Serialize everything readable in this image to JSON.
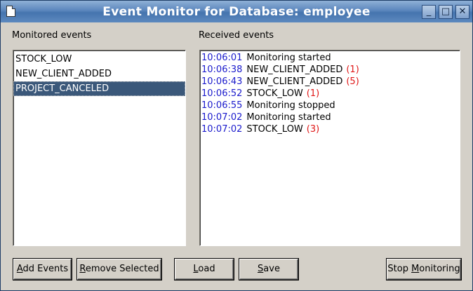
{
  "window": {
    "title": "Event Monitor for Database: employee",
    "min": "_",
    "max": "□",
    "close": "✕"
  },
  "monitored": {
    "label": "Monitored events",
    "items": [
      "STOCK_LOW",
      "NEW_CLIENT_ADDED",
      "PROJECT_CANCELED"
    ],
    "selected_index": 2
  },
  "received": {
    "label": "Received events",
    "rows": [
      {
        "time": "10:06:01",
        "message": "Monitoring started",
        "count": ""
      },
      {
        "time": "10:06:38",
        "message": "NEW_CLIENT_ADDED",
        "count": "(1)"
      },
      {
        "time": "10:06:43",
        "message": "NEW_CLIENT_ADDED",
        "count": "(5)"
      },
      {
        "time": "10:06:52",
        "message": "STOCK_LOW",
        "count": "(1)"
      },
      {
        "time": "10:06:55",
        "message": "Monitoring stopped",
        "count": ""
      },
      {
        "time": "10:07:02",
        "message": "Monitoring started",
        "count": ""
      },
      {
        "time": "10:07:02",
        "message": "STOCK_LOW",
        "count": "(3)"
      }
    ]
  },
  "buttons": {
    "add_events": {
      "mnemonic": "A",
      "rest": "dd Events"
    },
    "remove_selected": {
      "mnemonic": "R",
      "rest": "emove Selected"
    },
    "load": {
      "mnemonic": "L",
      "rest": "oad"
    },
    "save": {
      "mnemonic": "S",
      "rest": "ave"
    },
    "stop_monitoring": {
      "prefix": "Stop ",
      "mnemonic": "M",
      "rest": "onitoring"
    }
  },
  "colors": {
    "time": "#1a1acc",
    "count": "#e01818",
    "selection": "#3b587a"
  }
}
